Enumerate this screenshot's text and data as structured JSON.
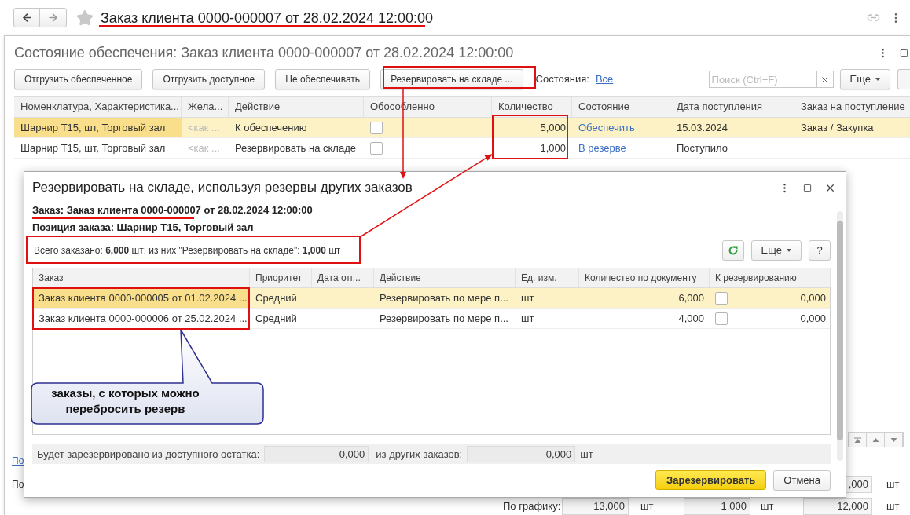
{
  "header": {
    "title": "Заказ клиента 0000-000007 от 28.02.2024 12:00:00"
  },
  "form": {
    "title": "Состояние обеспечения: Заказ клиента 0000-000007 от 28.02.2024 12:00:00",
    "toolbar": {
      "buttons": [
        {
          "label": "Отгрузить обеспеченное"
        },
        {
          "label": "Отгрузить доступное"
        },
        {
          "label": "Не обеспечивать"
        },
        {
          "label": "Резервировать на складе ..."
        }
      ],
      "states_label": "Состояния:",
      "states_value": "Все",
      "search_placeholder": "Поиск (Ctrl+F)",
      "more": "Еще"
    },
    "table": {
      "columns": [
        "Номенклатура, Характеристика...",
        "Жела...",
        "Действие",
        "Обособленно",
        "Количество",
        "Состояние",
        "Дата поступления",
        "Заказ на поступление"
      ],
      "rows": [
        {
          "selected": true,
          "item": "Шарнир Т15, шт, Торговый зал",
          "desired": "<как ...",
          "action": "К обеспечению",
          "checked": false,
          "quantity": "5,000",
          "state": "Обеспечить",
          "receipt_date": "15.03.2024",
          "receipt_order": "Заказ / Закупка"
        },
        {
          "selected": false,
          "item": "Шарнир Т15, шт, Торговый зал",
          "desired": "<как ...",
          "action": "Резервировать на складе",
          "checked": false,
          "quantity": "1,000",
          "state": "В резерве",
          "receipt_date": "Поступило"
        }
      ]
    },
    "bottom": {
      "link": "По",
      "label": "По",
      "field": ",000",
      "unit": "шт",
      "schedule_label": "По графику:",
      "schedule": [
        {
          "value": "13,000",
          "unit": "шт"
        },
        {
          "value": "1,000",
          "unit": "шт"
        },
        {
          "value": "12,000",
          "unit": "шт"
        }
      ]
    }
  },
  "dialog": {
    "title": "Резервировать на складе, используя резервы других заказов",
    "order_line": "Заказ: Заказ клиента 0000-000007 от 28.02.2024 12:00:00",
    "position_line": "Позиция заказа: Шарнир Т15, Торговый зал",
    "summary": "Всего заказано: **6,000** шт; из них \"Резервировать на складе\": **1,000** шт",
    "more": "Еще",
    "help": "?",
    "table": {
      "columns": [
        "Заказ",
        "Приоритет",
        "Дата отг...",
        "Действие",
        "Ед. изм.",
        "Количество по документу",
        "К резервированию"
      ],
      "rows": [
        {
          "selected": true,
          "order": "Заказ клиента 0000-000005 от 01.02.2024 ...",
          "priority": "Средний",
          "action": "Резервировать по мере п...",
          "unit": "шт",
          "quantity": "6,000",
          "checked": false,
          "to_reserve": "0,000"
        },
        {
          "selected": false,
          "order": "Заказ клиента 0000-000006 от 25.02.2024 ...",
          "priority": "Средний",
          "action": "Резервировать по мере п...",
          "unit": "шт",
          "quantity": "4,000",
          "checked": false,
          "to_reserve": "0,000"
        }
      ]
    },
    "footer": {
      "available_label": "Будет зарезервировано из доступного остатка:",
      "available_value": "0,000",
      "other_label": "из других заказов:",
      "other_value": "0,000",
      "unit": "шт"
    },
    "buttons": [
      {
        "label": "Зарезервировать",
        "kind": "primary"
      },
      {
        "label": "Отмена",
        "kind": "default"
      }
    ]
  },
  "annotation": {
    "callout": "заказы, с которых можно перебросить резерв"
  }
}
